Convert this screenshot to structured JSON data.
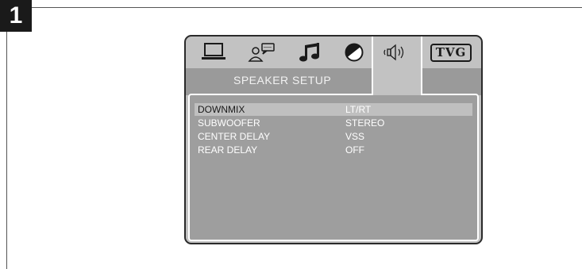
{
  "step": {
    "number": "1"
  },
  "tabs": [
    {
      "name": "general",
      "icon": "monitor-icon"
    },
    {
      "name": "language",
      "icon": "person-speech-icon"
    },
    {
      "name": "audio",
      "icon": "music-note-icon"
    },
    {
      "name": "video",
      "icon": "half-circle-icon"
    },
    {
      "name": "speaker",
      "icon": "speaker-icon",
      "active": true
    },
    {
      "name": "tvg",
      "label": "TVG"
    }
  ],
  "menu": {
    "title": "SPEAKER  SETUP",
    "items": [
      {
        "label": "DOWNMIX",
        "value": "LT/RT",
        "selected": true
      },
      {
        "label": "SUBWOOFER",
        "value": "STEREO"
      },
      {
        "label": "CENTER DELAY",
        "value": "VSS"
      },
      {
        "label": "REAR DELAY",
        "value": "OFF"
      }
    ]
  },
  "colors": {
    "screen_bg": "#c2c2c2",
    "title_bar": "#9a9a9a",
    "content_bg": "#9e9e9e",
    "selected_row": "#bfbfbf",
    "badge": "#1a1a1a"
  }
}
